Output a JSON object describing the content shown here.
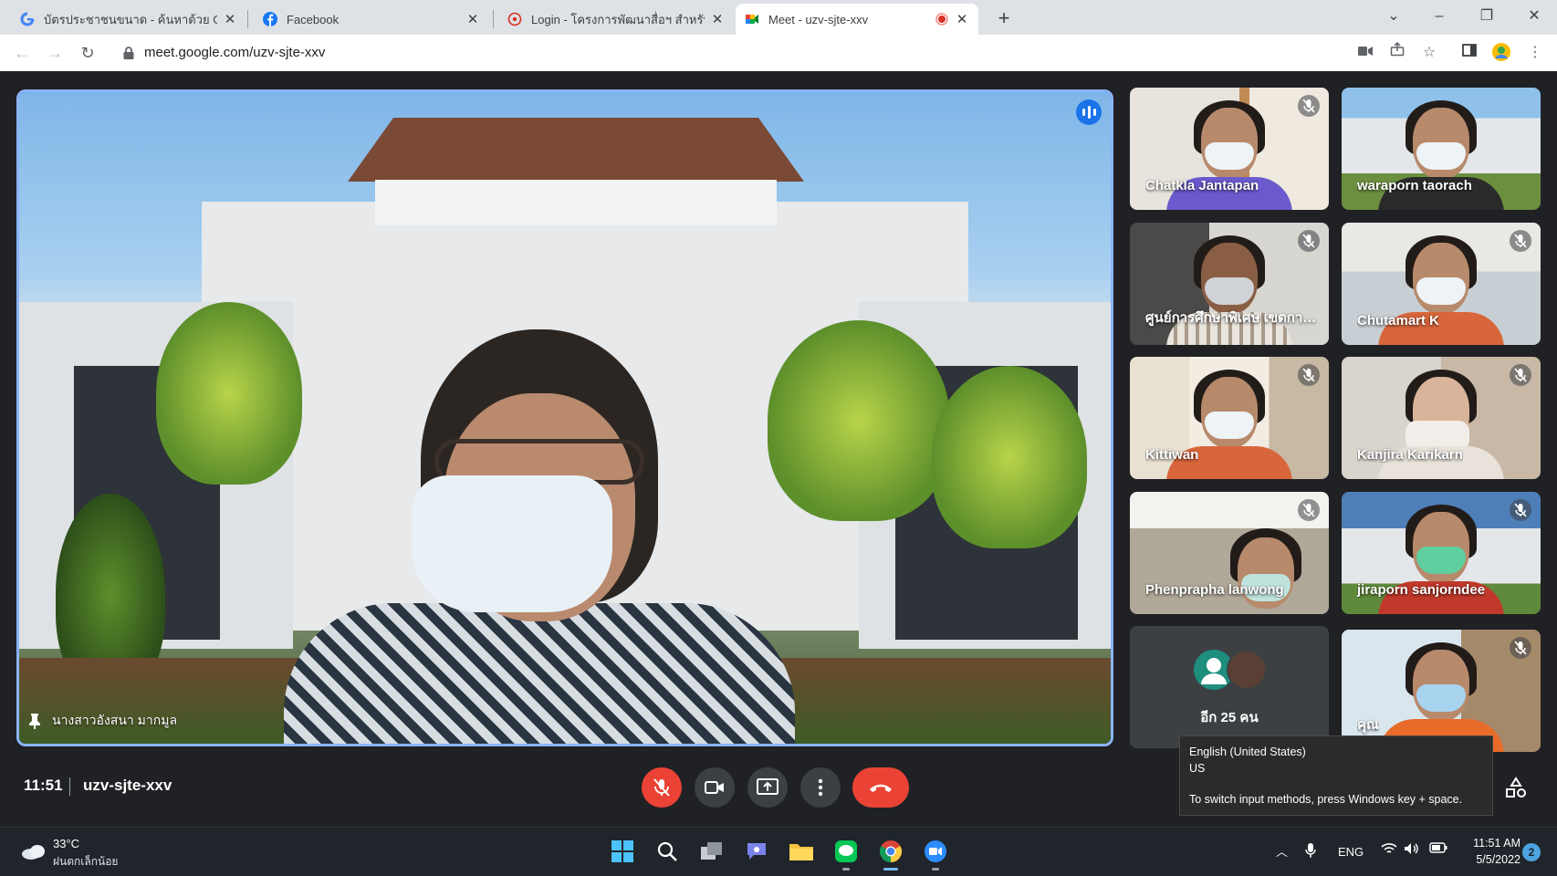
{
  "browser": {
    "tabs": [
      {
        "label": "บัตรประชาชนขนาด - ค้นหาด้วย Goo",
        "icon": "google-icon",
        "active": false
      },
      {
        "label": "Facebook",
        "icon": "facebook-icon",
        "active": false
      },
      {
        "label": "Login - โครงการพัฒนาสื่อฯ สำหรับผ",
        "icon": "login-site-icon",
        "active": false
      },
      {
        "label": "Meet - uzv-sjte-xxv",
        "icon": "meet-icon",
        "active": true,
        "recording": true
      }
    ],
    "url": "meet.google.com/uzv-sjte-xxv"
  },
  "meet": {
    "main_speaker": {
      "name": "นางสาวอังสนา มากมูล",
      "pinned": true,
      "speaking": true
    },
    "participants": [
      {
        "name": "Chatkla Jantapan",
        "muted": true
      },
      {
        "name": "waraporn taorach",
        "muted": false
      },
      {
        "name": "ศูนย์การศึกษาพิเศษ เขตการ...",
        "muted": true
      },
      {
        "name": "Chutamart K",
        "muted": true
      },
      {
        "name": "Kittiwan",
        "muted": true
      },
      {
        "name": "Kanjira Karikarn",
        "muted": true
      },
      {
        "name": "Phenprapha lanwong",
        "muted": true
      },
      {
        "name": "jiraporn sanjorndee",
        "muted": true
      },
      {
        "name": "คุณ",
        "muted": true
      }
    ],
    "others": {
      "label": "อีก 25 คน"
    },
    "controls": {
      "time": "11:51",
      "meeting_code": "uzv-sjte-xxv"
    },
    "tooltip": {
      "line1": "English (United States)",
      "line2": "US",
      "line3": "To switch input methods, press Windows key + space."
    }
  },
  "taskbar": {
    "weather": {
      "temp": "33°C",
      "condition": "ฝนตกเล็กน้อย"
    },
    "language": "ENG",
    "time": "11:51 AM",
    "date": "5/5/2022",
    "notifications": "2"
  },
  "colors": {
    "accent": "#8ab4f8",
    "end_call": "#ea4335",
    "meet_bg": "#202124",
    "taskbar_bg": "#20242b"
  }
}
